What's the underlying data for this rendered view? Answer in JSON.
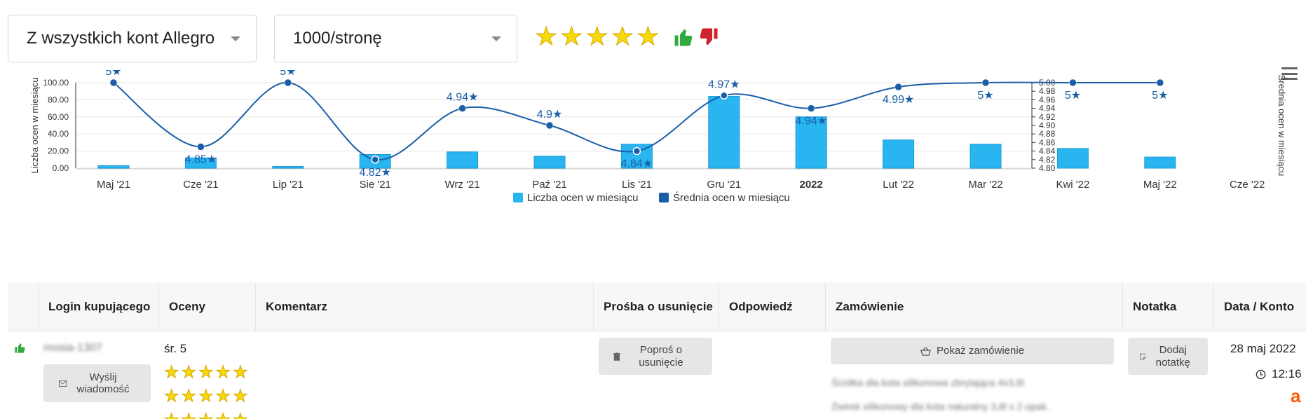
{
  "filters": {
    "accounts_value": "Z wszystkich kont Allegro",
    "per_page_value": "1000/stronę",
    "star_count": 5,
    "thumb_up_color": "#2eaa3f",
    "thumb_down_color": "#d0222a"
  },
  "menu": {
    "icon": "hamburger-menu-icon"
  },
  "chart_data": {
    "type": "bar+line",
    "x_labels": [
      "Maj '21",
      "Cze '21",
      "Lip '21",
      "Sie '21",
      "Wrz '21",
      "Paź '21",
      "Lis '21",
      "Gru '21",
      "2022",
      "Lut '22",
      "Mar '22",
      "Kwi '22",
      "Maj '22",
      "Cze '22"
    ],
    "bold_label": "2022",
    "left_axis": {
      "label": "Liczba ocen w miesiącu",
      "ticks": [
        "0.00",
        "20.00",
        "40.00",
        "60.00",
        "80.00",
        "100.00"
      ],
      "range": [
        0,
        100
      ]
    },
    "right_axis": {
      "label": "Średnia ocen w miesiącu",
      "ticks": [
        "4.80",
        "4.82",
        "4.84",
        "4.86",
        "4.88",
        "4.90",
        "4.92",
        "4.94",
        "4.96",
        "4.98",
        "5.00"
      ],
      "range": [
        4.8,
        5.0
      ]
    },
    "series": [
      {
        "name": "Liczba ocen w miesiącu",
        "type": "bar",
        "color": "#29b6f0",
        "values": [
          3,
          12,
          2,
          16,
          19,
          14,
          28,
          84,
          60,
          33,
          28,
          23,
          13
        ]
      },
      {
        "name": "Średnia ocen w miesiącu",
        "type": "line",
        "color": "#1a5ea8",
        "values": [
          5.0,
          4.85,
          5.0,
          4.82,
          4.94,
          4.9,
          4.84,
          4.97,
          4.94,
          4.99,
          5.0,
          5.0,
          5.0
        ],
        "point_labels": [
          "5★",
          "4.85★",
          "5★",
          "4.82★",
          "4.94★",
          "4.9★",
          "4.84★",
          "4.97★",
          "4.94★",
          "4.99★",
          "5★",
          "5★",
          "5★"
        ]
      }
    ],
    "legend_position": "bottom"
  },
  "table": {
    "headers": [
      "Login kupującego",
      "Oceny",
      "Komentarz",
      "Prośba o usunięcie",
      "Odpowiedź",
      "Zamówienie",
      "Notatka",
      "Data / Konto"
    ],
    "row": {
      "login": "mosia-1307",
      "send_message": "Wyślij wiadomość",
      "avg_label": "śr. 5",
      "remove_request": "Poproś o usunięcie",
      "show_order": "Pokaż zamówienie",
      "order_line_1": "Ściółka dla kota silikonowa zbrylająca 4x3,8l",
      "order_line_2": "Żwirek silikonowy dla kota naturalny 3,8l x 2 opak.",
      "add_note": "Dodaj notatkę",
      "date": "28 maj 2022",
      "time": "12:16",
      "platform_badge": "a"
    }
  }
}
